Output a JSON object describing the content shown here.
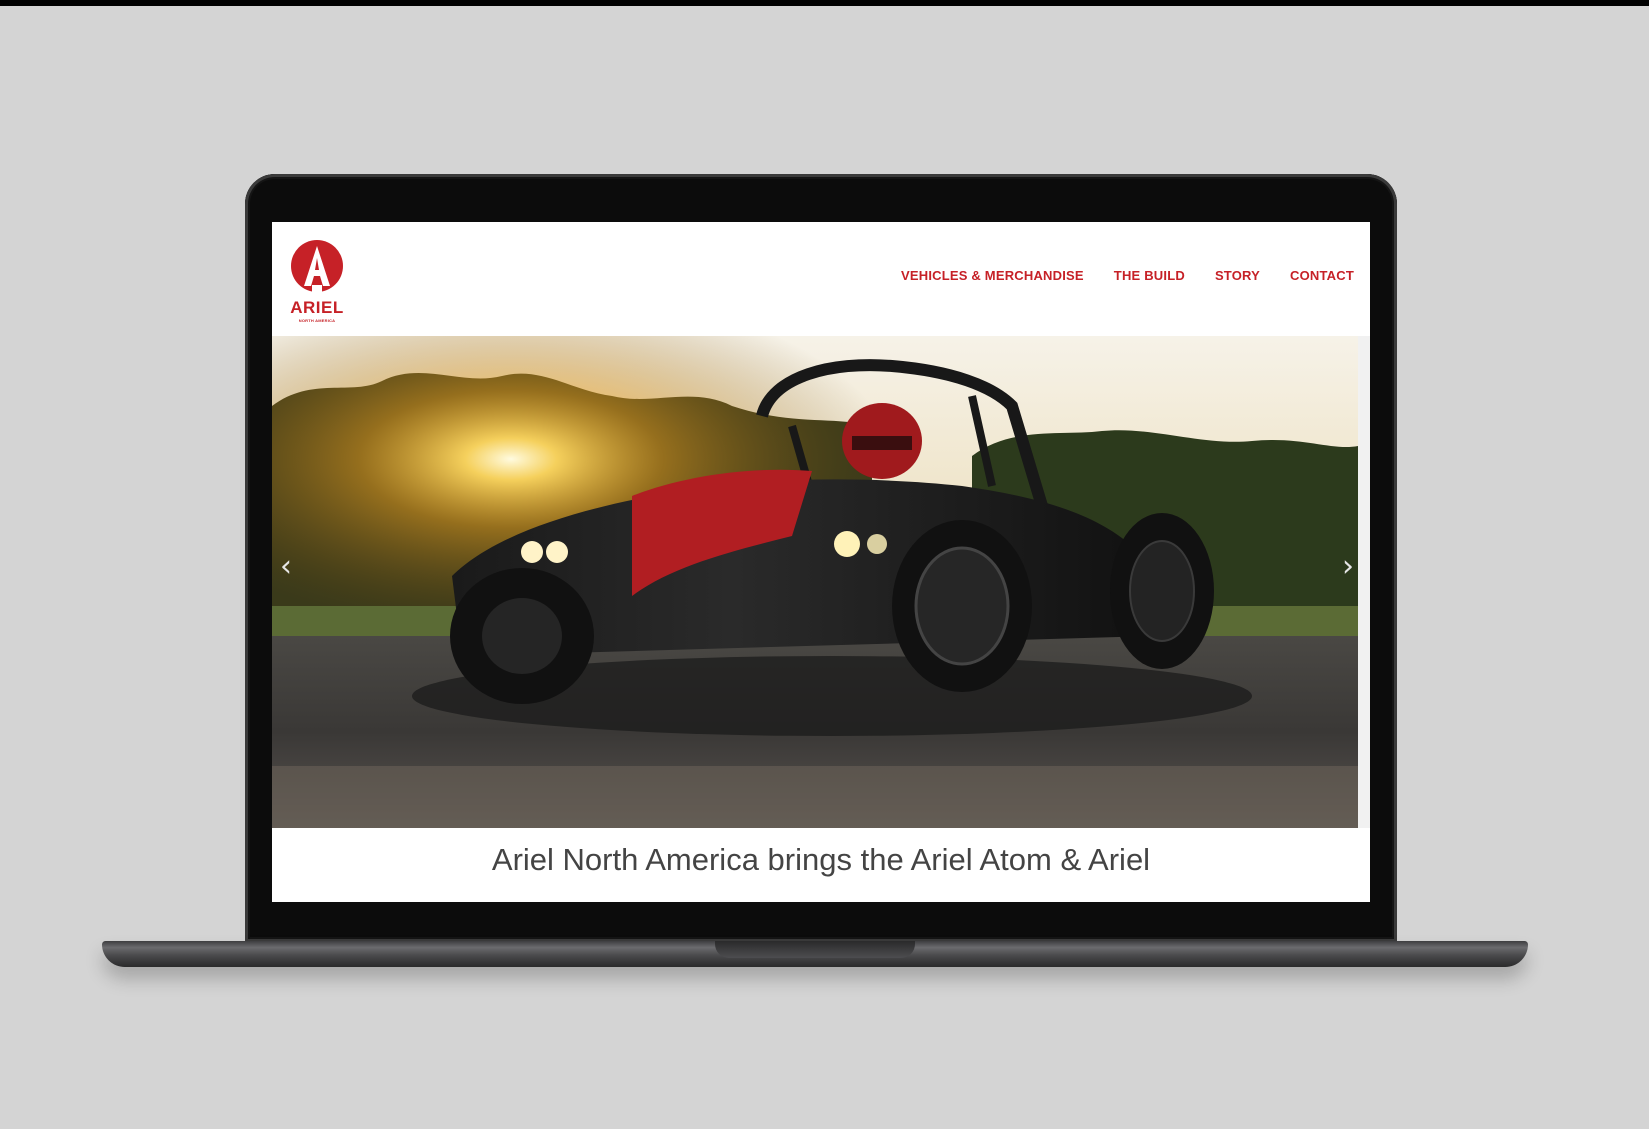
{
  "brand": {
    "name": "ARIEL",
    "subtitle": "NORTH AMERICA",
    "accent_color": "#c62127"
  },
  "nav": {
    "items": [
      {
        "label": "VEHICLES & MERCHANDISE"
      },
      {
        "label": "THE BUILD"
      },
      {
        "label": "STORY"
      },
      {
        "label": "CONTACT"
      }
    ]
  },
  "hero": {
    "prev_icon": "chevron-left-icon",
    "next_icon": "chevron-right-icon",
    "prev_glyph": "‹",
    "next_glyph": "›"
  },
  "intro": {
    "headline": "Ariel North America brings the Ariel Atom & Ariel"
  }
}
